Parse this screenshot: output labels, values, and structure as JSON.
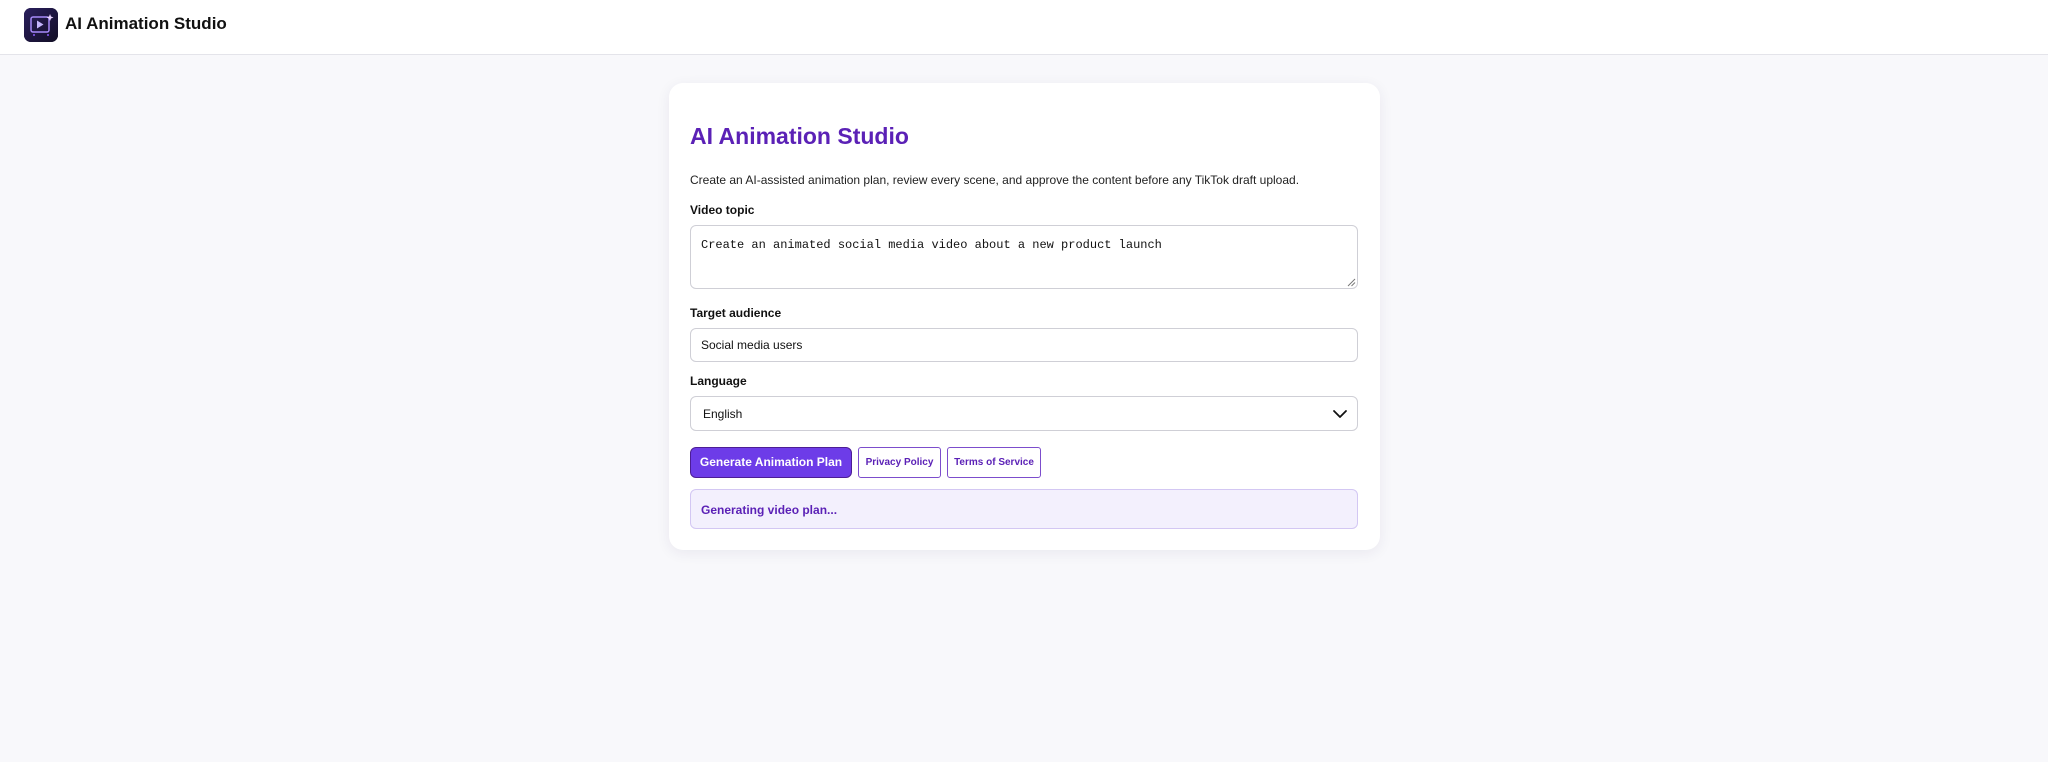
{
  "header": {
    "app_title": "AI Animation Studio",
    "logo_icon": "play-sparkle-icon"
  },
  "main": {
    "title": "AI Animation Studio",
    "description": "Create an AI-assisted animation plan, review every scene, and approve the content before any TikTok draft upload.",
    "fields": {
      "video_topic": {
        "label": "Video topic",
        "value": "Create an animated social media video about a new product launch"
      },
      "target_audience": {
        "label": "Target audience",
        "value": "Social media users"
      },
      "language": {
        "label": "Language",
        "selected": "English",
        "icon": "chevron-down-icon"
      }
    },
    "buttons": {
      "generate": "Generate Animation Plan",
      "privacy": "Privacy Policy",
      "terms": "Terms of Service"
    },
    "status": "Generating video plan..."
  },
  "colors": {
    "accent": "#5b21b6",
    "primary_button": "#6d3ce8",
    "status_background": "#f3f0fd",
    "page_background": "#f8f8fb"
  }
}
